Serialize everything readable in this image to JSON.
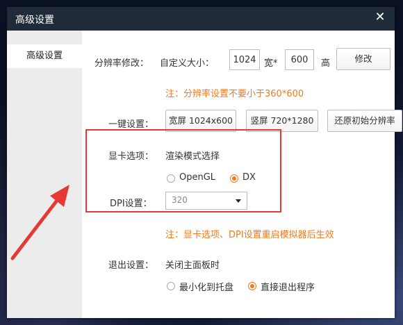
{
  "window": {
    "title": "高级设置",
    "close_glyph": "✕"
  },
  "sidebar": {
    "items": [
      {
        "label": "高级设置"
      }
    ]
  },
  "resolution": {
    "label": "分辨率修改：",
    "custom_label": "自定义大小：",
    "width_value": "1024",
    "width_sep": "宽*",
    "height_value": "600",
    "height_suffix": "高",
    "apply_label": "修改",
    "note": "注：分辨率设置不要小于360*600"
  },
  "quick_set": {
    "label": "一键设置：",
    "landscape_label": "宽屏 1024x600",
    "portrait_label": "竖屏 720*1280",
    "restore_label": "还原初始分辨率"
  },
  "gpu": {
    "label": "显卡选项：",
    "mode_label": "渲染模式选择",
    "options": [
      {
        "label": "OpenGL",
        "selected": false
      },
      {
        "label": "DX",
        "selected": true
      }
    ]
  },
  "dpi": {
    "label": "DPI设置：",
    "value": "320"
  },
  "restart_note": "注：显卡选项、DPI设置重启模拟器后生效",
  "exit": {
    "label": "退出设置：",
    "desc": "关闭主面板时",
    "options": [
      {
        "label": "最小化到托盘",
        "selected": false
      },
      {
        "label": "直接退出程序",
        "selected": true
      }
    ]
  },
  "colors": {
    "accent": "#f07a1a",
    "highlight": "#e53935",
    "titlebar": "#1f2b38"
  }
}
